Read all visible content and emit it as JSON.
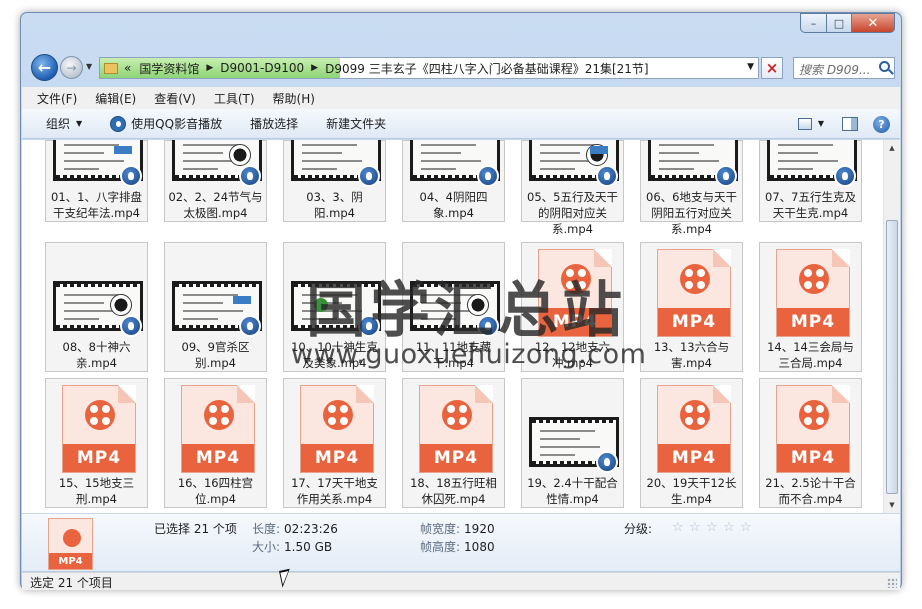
{
  "window": {
    "min_glyph": "–",
    "max_glyph": "□",
    "close_glyph": "✕"
  },
  "nav": {
    "back_glyph": "←",
    "forward_glyph": "→",
    "breadcrumb_prefix": "«",
    "breadcrumbs": [
      "国学资料馆",
      "D9001-D9100",
      "D9099 三丰玄子《四柱八字入门必备基础课程》21集[21节]"
    ],
    "search_placeholder": "搜索 D909..."
  },
  "menu": [
    "文件(F)",
    "编辑(E)",
    "查看(V)",
    "工具(T)",
    "帮助(H)"
  ],
  "toolbar": {
    "organize": "组织",
    "play_qq": "使用QQ影音播放",
    "play_selected": "播放选择",
    "new_folder": "新建文件夹"
  },
  "files": [
    {
      "label": "01、1、八字排盘干支纪年法.mp4",
      "thumb": "video"
    },
    {
      "label": "02、2、24节气与太极图.mp4",
      "thumb": "video"
    },
    {
      "label": "03、3、阴阳.mp4",
      "thumb": "video"
    },
    {
      "label": "04、4阴阳四象.mp4",
      "thumb": "video"
    },
    {
      "label": "05、5五行及天干的阴阳对应关系.mp4",
      "thumb": "video"
    },
    {
      "label": "06、6地支与天干阴阳五行对应关系.mp4",
      "thumb": "video"
    },
    {
      "label": "07、7五行生克及天干生克.mp4",
      "thumb": "video"
    },
    {
      "label": "08、8十神六亲.mp4",
      "thumb": "video"
    },
    {
      "label": "09、9官杀区别.mp4",
      "thumb": "video"
    },
    {
      "label": "10、10十神生克及类象.mp4",
      "thumb": "video"
    },
    {
      "label": "11、11地支藏干.mp4",
      "thumb": "video"
    },
    {
      "label": "12、12地支六冲.mp4",
      "thumb": "icon"
    },
    {
      "label": "13、13六合与害.mp4",
      "thumb": "icon"
    },
    {
      "label": "14、14三会局与三合局.mp4",
      "thumb": "icon"
    },
    {
      "label": "15、15地支三刑.mp4",
      "thumb": "icon"
    },
    {
      "label": "16、16四柱宫位.mp4",
      "thumb": "icon"
    },
    {
      "label": "17、17天干地支作用关系.mp4",
      "thumb": "icon"
    },
    {
      "label": "18、18五行旺相休囚死.mp4",
      "thumb": "icon"
    },
    {
      "label": "19、2.4十干配合性情.mp4",
      "thumb": "video"
    },
    {
      "label": "20、19天干12长生.mp4",
      "thumb": "icon"
    },
    {
      "label": "21、2.5论十干合而不合.mp4",
      "thumb": "icon"
    }
  ],
  "mp4_text": "MP4",
  "watermark": {
    "title": "国学汇总站",
    "url": "www.guoxuehuizong.com"
  },
  "details": {
    "selected": "已选择 21 个项",
    "length_label": "长度:",
    "length_value": "02:23:26",
    "size_label": "大小:",
    "size_value": "1.50 GB",
    "frame_width_label": "帧宽度:",
    "frame_width_value": "1920",
    "frame_height_label": "帧高度:",
    "frame_height_value": "1080",
    "rating_label": "分级:",
    "rating_stars": 0
  },
  "status": "选定 21 个项目"
}
